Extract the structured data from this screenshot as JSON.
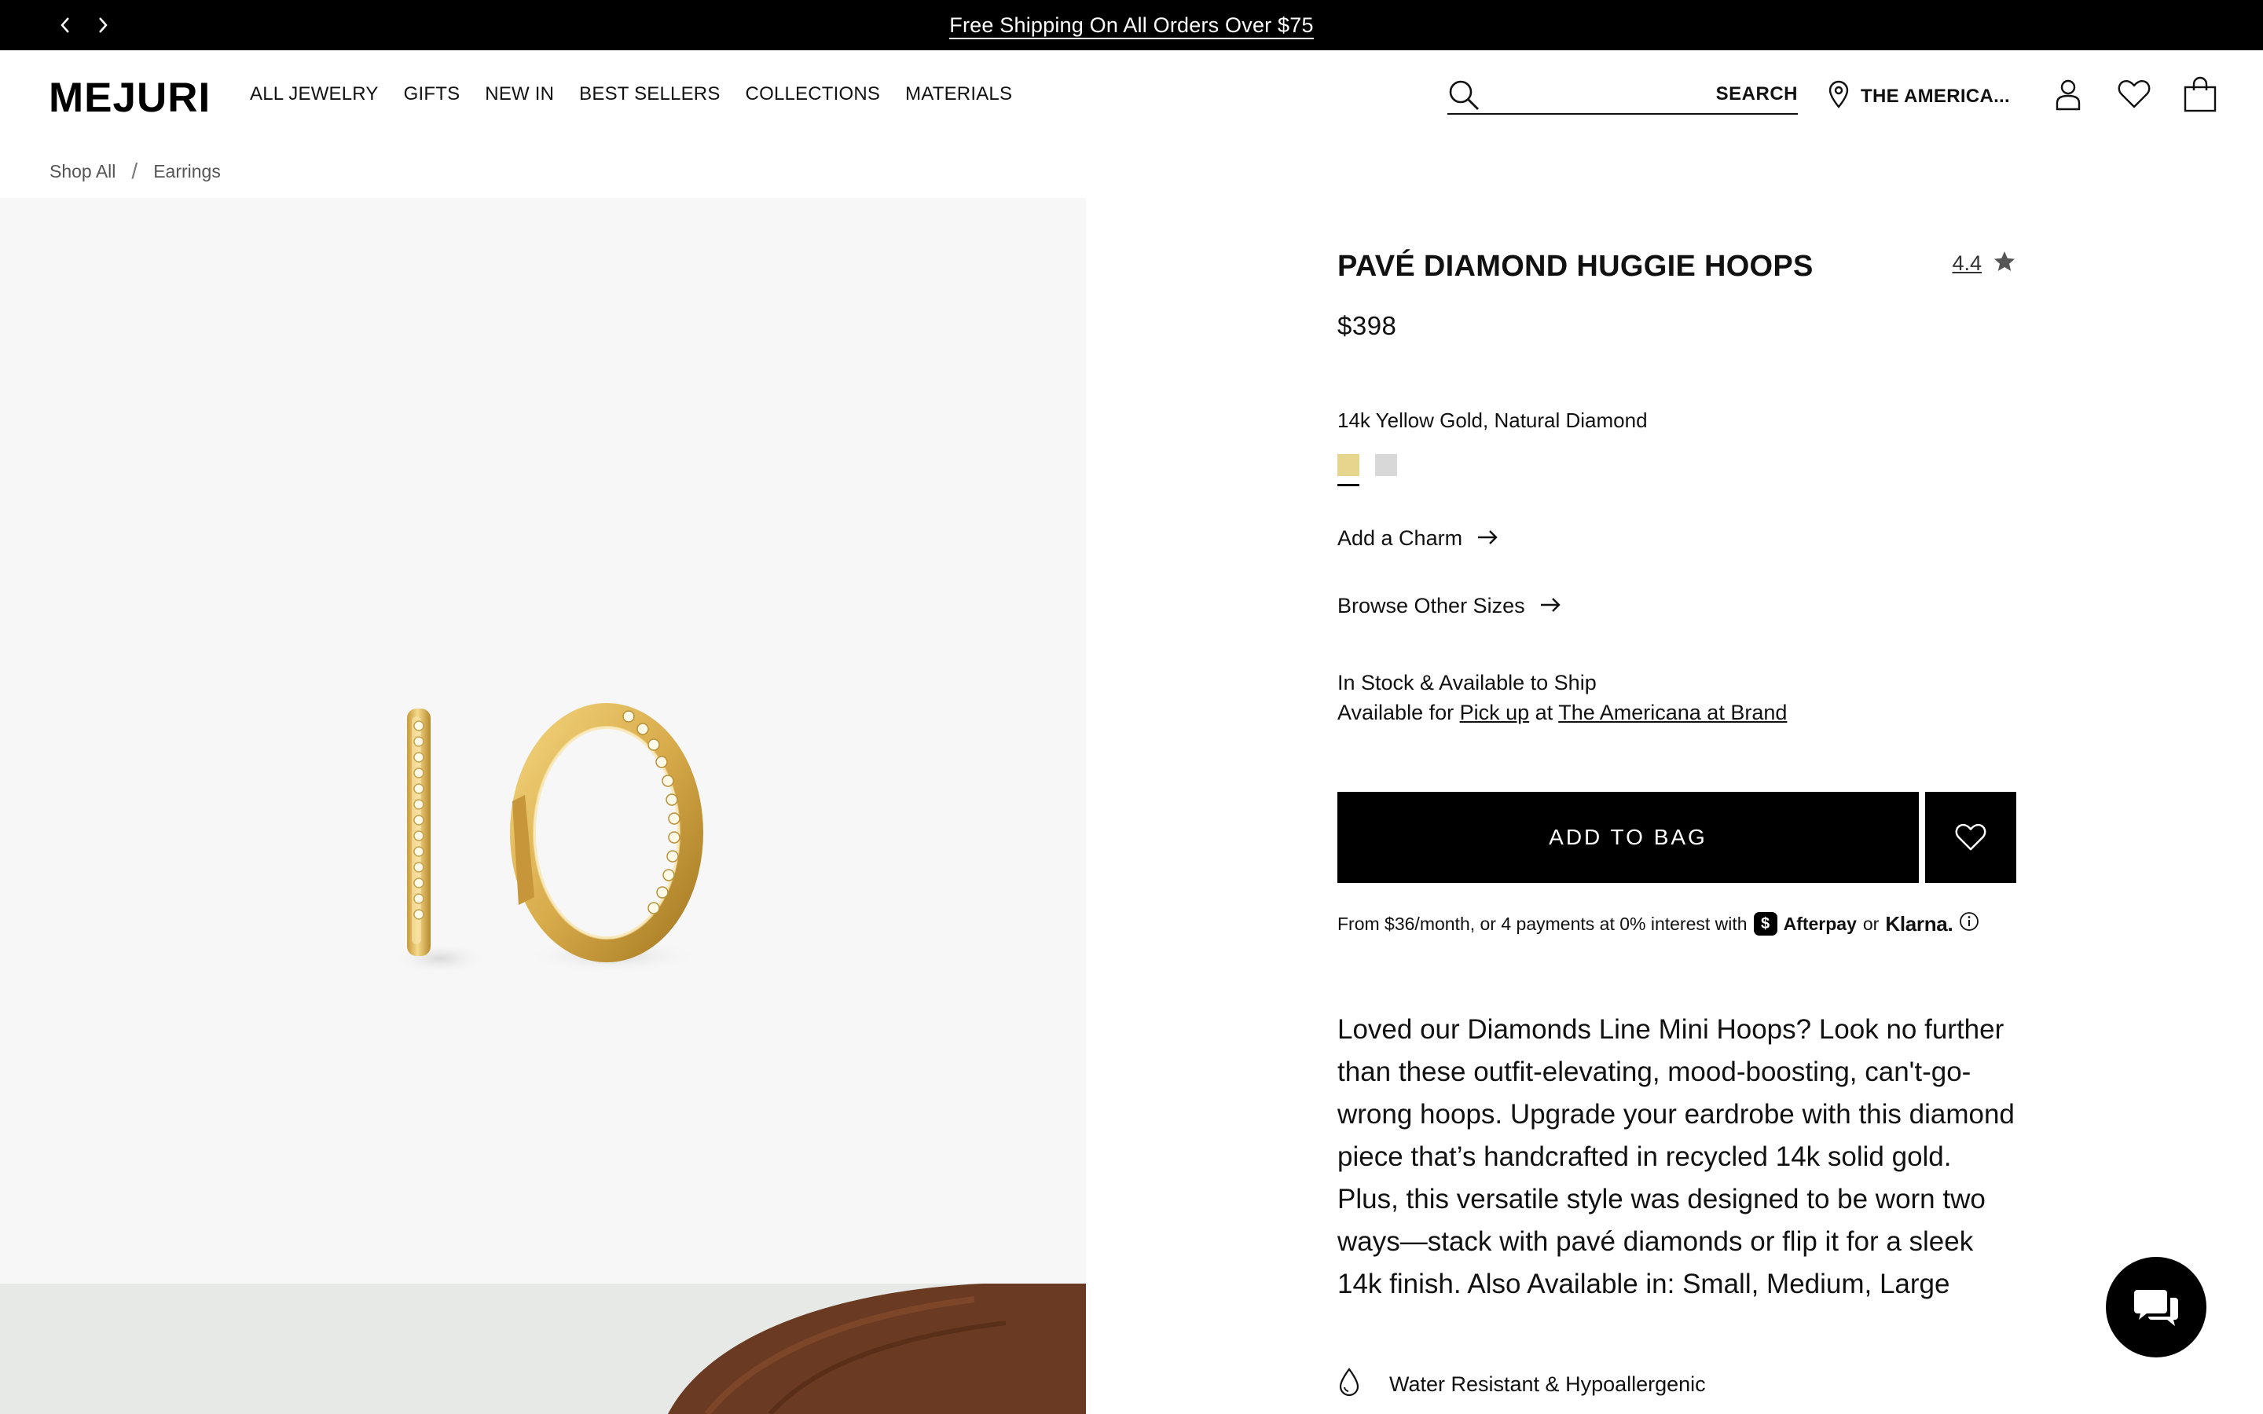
{
  "announcement": {
    "text": "Free Shipping On All Orders Over $75"
  },
  "header": {
    "logo": "MEJURI",
    "nav": [
      "ALL JEWELRY",
      "GIFTS",
      "NEW IN",
      "BEST SELLERS",
      "COLLECTIONS",
      "MATERIALS"
    ],
    "search": {
      "placeholder": "",
      "button_label": "SEARCH"
    },
    "store_label": "THE AMERICA..."
  },
  "breadcrumb": {
    "items": [
      "Shop All",
      "Earrings"
    ],
    "separator": "/"
  },
  "product": {
    "title": "PAVÉ DIAMOND HUGGIE HOOPS",
    "rating": "4.4",
    "price": "$398",
    "material": "14k Yellow Gold, Natural Diamond",
    "swatches": [
      {
        "name": "yellow-gold",
        "color": "#e8d58d",
        "selected": true
      },
      {
        "name": "white-gold",
        "color": "#d8d8d8",
        "selected": false
      }
    ],
    "add_charm": "Add a Charm",
    "browse_sizes": "Browse Other Sizes",
    "stock_line": "In Stock & Available to Ship",
    "pickup": {
      "prefix": "Available for",
      "link": "Pick up",
      "mid": "at",
      "store": "The Americana at Brand"
    },
    "add_to_bag": "ADD TO BAG",
    "pay_later": {
      "text": "From $36/month, or 4 payments at 0% interest with",
      "afterpay": "Afterpay",
      "or": "or",
      "klarna": "Klarna."
    },
    "description": "Loved our Diamonds Line Mini Hoops? Look no further than these outfit-elevating, mood-boosting, can't-go-wrong hoops. Upgrade your eardrobe with this diamond piece that’s handcrafted in recycled 14k solid gold. Plus, this versatile style was designed to be worn two ways—stack with pavé diamonds or flip it for a sleek 14k finish. Also Available in: Small, Medium, Large",
    "feature": "Water Resistant & Hypoallergenic"
  },
  "colors": {
    "accent": "#000000",
    "gold": "#d9b25a",
    "background": "#f7f7f7"
  }
}
